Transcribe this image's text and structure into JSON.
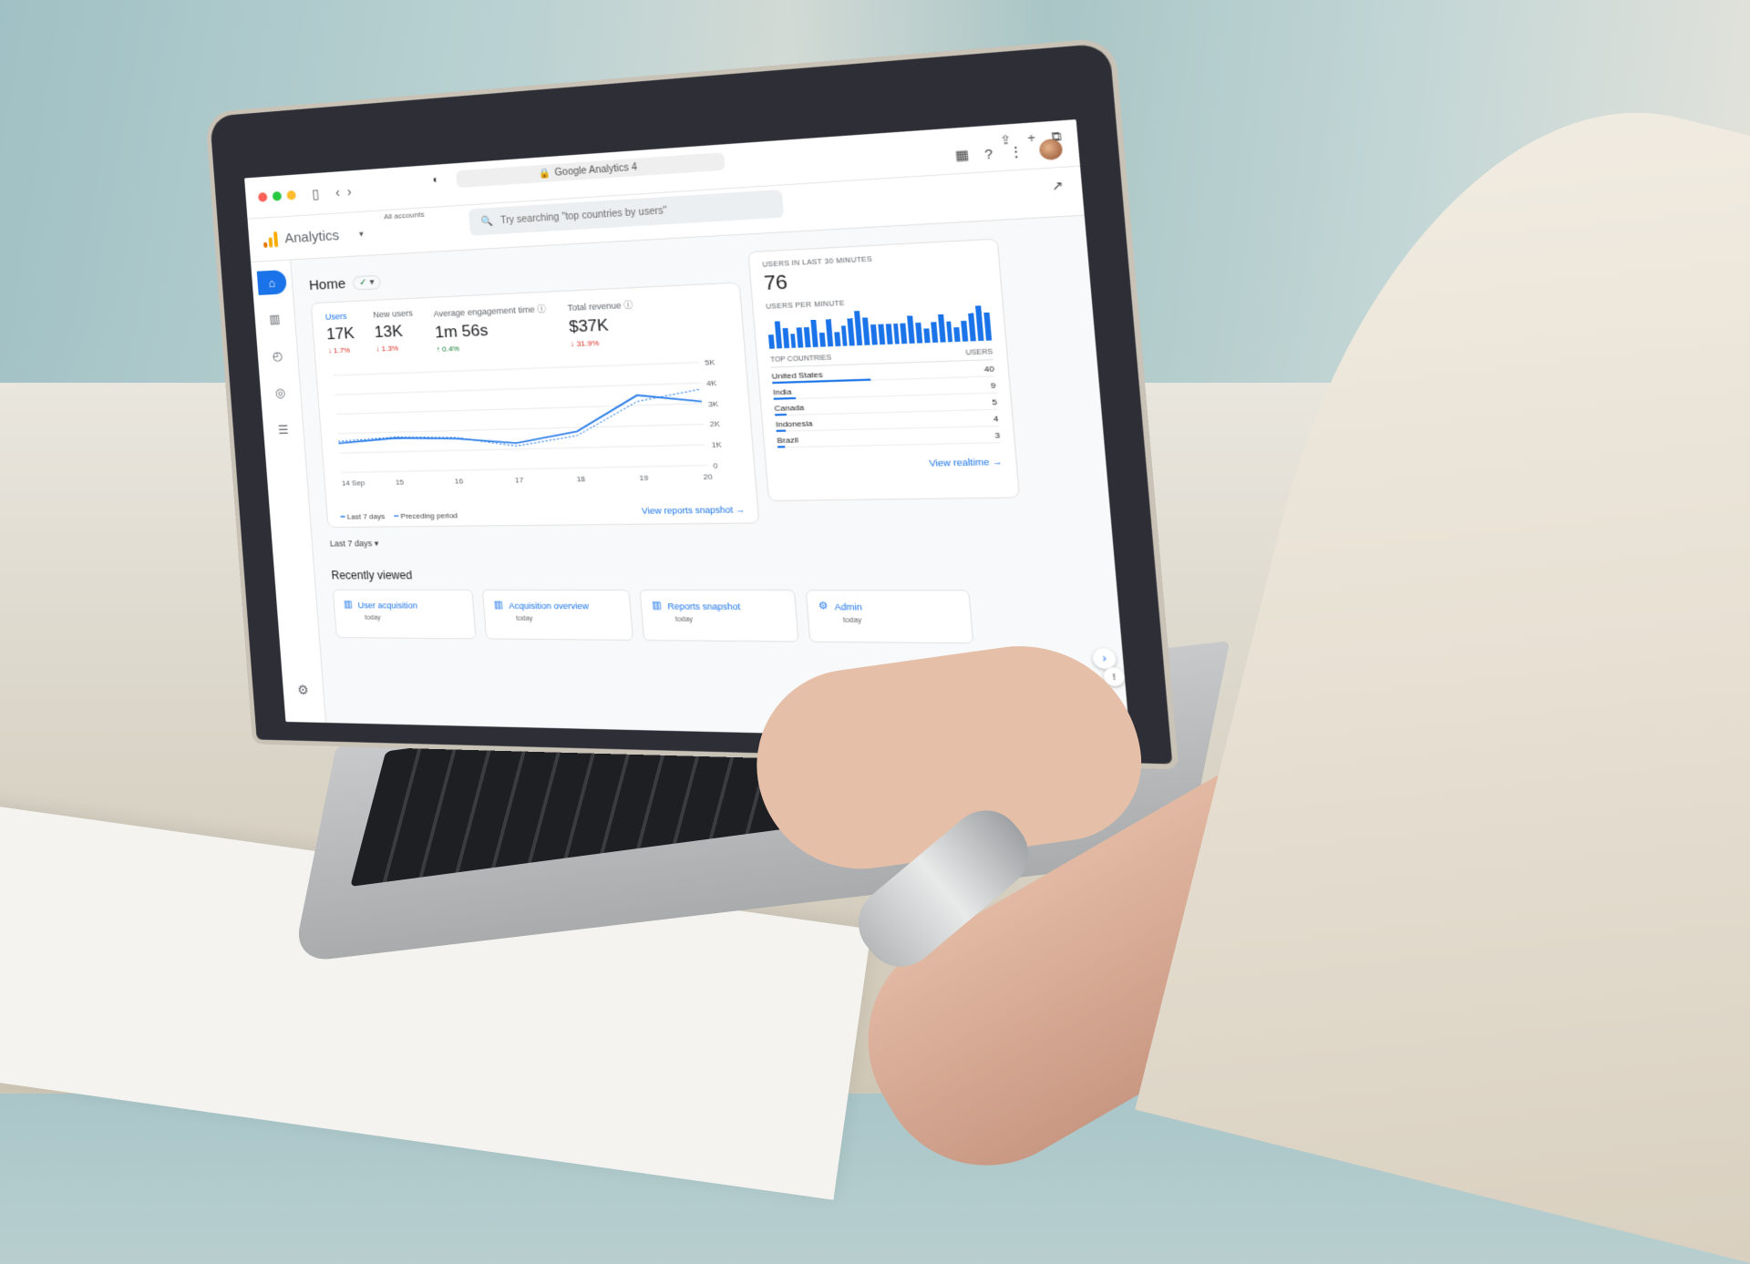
{
  "browser": {
    "tab_title": "Google Analytics 4",
    "lock_icon": "lock-icon",
    "traffic_lights": [
      "#ff5f57",
      "#28c840",
      "#febc2e"
    ]
  },
  "header": {
    "brand": "Analytics",
    "account_label": "All accounts",
    "search_placeholder": "Try searching \"top countries by users\"",
    "icons": [
      "apps-grid-icon",
      "help-icon",
      "more-vert-icon",
      "avatar"
    ]
  },
  "sidebar": {
    "items": [
      {
        "name": "home",
        "icon": "⌂",
        "active": true
      },
      {
        "name": "reports",
        "icon": "▥",
        "active": false
      },
      {
        "name": "explore",
        "icon": "◴",
        "active": false
      },
      {
        "name": "advertising",
        "icon": "◎",
        "active": false
      },
      {
        "name": "configure",
        "icon": "☰",
        "active": false
      }
    ],
    "settings_icon": "⚙"
  },
  "home": {
    "title": "Home",
    "status_icon": "✓",
    "caret": "▾",
    "kpis": [
      {
        "label": "Users",
        "value": "17K",
        "delta": "↓ 1.7%",
        "direction": "down",
        "selected": true
      },
      {
        "label": "New users",
        "value": "13K",
        "delta": "↓ 1.3%",
        "direction": "down",
        "selected": false
      },
      {
        "label": "Average engagement time ⓘ",
        "value": "1m 56s",
        "delta": "↑ 0.4%",
        "direction": "up",
        "selected": false
      },
      {
        "label": "Total revenue ⓘ",
        "value": "$37K",
        "delta": "↓ 31.9%",
        "direction": "down",
        "selected": false
      }
    ],
    "legend": {
      "current": "Last 7 days",
      "previous": "Preceding period"
    },
    "view_snapshot": "View reports snapshot →",
    "date_range": "Last 7 days ▾"
  },
  "chart_data": {
    "type": "line",
    "x": [
      "14 Sep",
      "15",
      "16",
      "17",
      "18",
      "19",
      "20"
    ],
    "series": [
      {
        "name": "Last 7 days",
        "style": "solid",
        "values": [
          1500,
          1700,
          1600,
          1300,
          1800,
          3500,
          3100
        ]
      },
      {
        "name": "Preceding period",
        "style": "dashed",
        "values": [
          1600,
          1750,
          1650,
          1150,
          1600,
          3200,
          3700
        ]
      }
    ],
    "yticks": [
      "0",
      "1K",
      "2K",
      "3K",
      "4K",
      "5K"
    ],
    "ylim": [
      0,
      5000
    ],
    "ylabel": "",
    "xlabel": "",
    "grid": true,
    "legend": "bottom-left"
  },
  "realtime": {
    "title": "USERS IN LAST 30 MINUTES",
    "value": "76",
    "per_minute_label": "USERS PER MINUTE",
    "per_minute": [
      2,
      4,
      3,
      2,
      3,
      3,
      4,
      2,
      4,
      2,
      3,
      4,
      5,
      4,
      3,
      3,
      3,
      3,
      3,
      4,
      3,
      2,
      3,
      4,
      3,
      2,
      3,
      4,
      5,
      4
    ],
    "countries_header": "TOP COUNTRIES",
    "users_header": "USERS",
    "countries": [
      {
        "name": "United States",
        "users": "40",
        "share": 1.0
      },
      {
        "name": "India",
        "users": "9",
        "share": 0.225
      },
      {
        "name": "Canada",
        "users": "5",
        "share": 0.125
      },
      {
        "name": "Indonesia",
        "users": "4",
        "share": 0.1
      },
      {
        "name": "Brazil",
        "users": "3",
        "share": 0.075
      }
    ],
    "view_realtime": "View realtime →"
  },
  "recent": {
    "title": "Recently viewed",
    "items": [
      {
        "label": "User acquisition",
        "when": "today",
        "icon": "report-icon"
      },
      {
        "label": "Acquisition overview",
        "when": "today",
        "icon": "report-icon"
      },
      {
        "label": "Reports snapshot",
        "when": "today",
        "icon": "report-icon"
      },
      {
        "label": "Admin",
        "when": "today",
        "icon": "gear-icon"
      }
    ]
  },
  "colors": {
    "accent": "#1a73e8",
    "down": "#d93025",
    "up": "#188038"
  }
}
